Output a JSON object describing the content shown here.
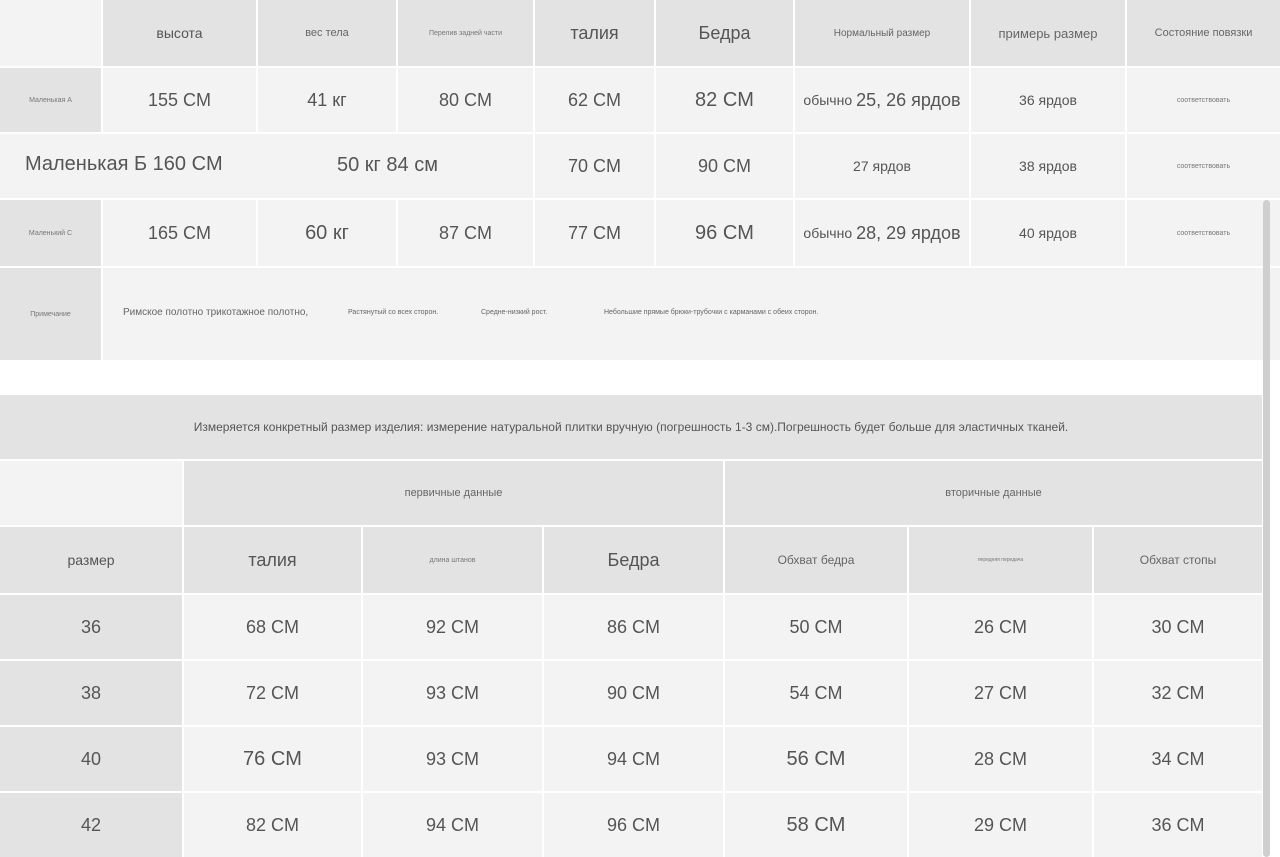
{
  "table1": {
    "headers": [
      "высота",
      "вес тела",
      "Перелив задней части",
      "талия",
      "Бедра",
      "Нормальный размер",
      "примерь размер",
      "Состояние повязки"
    ],
    "rows": [
      {
        "label": "Маленькая А",
        "cells": [
          "155 CM",
          "41 кг",
          "80 CM",
          "62 CM",
          "82 CM"
        ],
        "normal_prefix": "обычно",
        "normal_value": "25, 26 ярдов",
        "fit": "36 ярдов",
        "band": "соответствовать"
      },
      {
        "label_full": "Маленькая Б 160 CM",
        "weight_chest": "50 кг 84 см",
        "cells": [
          "70 CM",
          "90 CM"
        ],
        "normal_value": "27 ярдов",
        "fit": "38 ярдов",
        "band": "соответствовать"
      },
      {
        "label": "Маленький C",
        "cells": [
          "165 CM",
          "60 кг",
          "87 CM",
          "77 CM",
          "96 CM"
        ],
        "normal_prefix": "обычно",
        "normal_value": "28, 29 ярдов",
        "fit": "40 ярдов",
        "band": "соответствовать"
      }
    ],
    "note": {
      "label": "Примечание",
      "parts": [
        "Римское полотно трикотажное полотно,",
        "Растянутый со всех сторон.",
        "Средне-низкий рост.",
        "Небольшие прямые брюки-трубочки с карманами с обеих сторон."
      ]
    }
  },
  "table2": {
    "caption": "Измеряется конкретный размер изделия: измерение натуральной плитки вручную (погрешность 1-3 см).Погрешность будет больше для эластичных тканей.",
    "group_primary": "первичные данные",
    "group_secondary": "вторичные данные",
    "headers": [
      "размер",
      "талия",
      "длина штанов",
      "Бедра",
      "Обхват бедра",
      "передняя передача",
      "Обхват стопы"
    ],
    "rows": [
      [
        "36",
        "68 CM",
        "92 CM",
        "86 CM",
        "50 CM",
        "26 CM",
        "30 CM"
      ],
      [
        "38",
        "72 CM",
        "93 CM",
        "90 CM",
        "54 CM",
        "27 CM",
        "32 CM"
      ],
      [
        "40",
        "76 CM",
        "93 CM",
        "94 CM",
        "56 CM",
        "28 CM",
        "34 CM"
      ],
      [
        "42",
        "82 CM",
        "94 CM",
        "96 CM",
        "58 CM",
        "29 CM",
        "36 CM"
      ]
    ]
  }
}
